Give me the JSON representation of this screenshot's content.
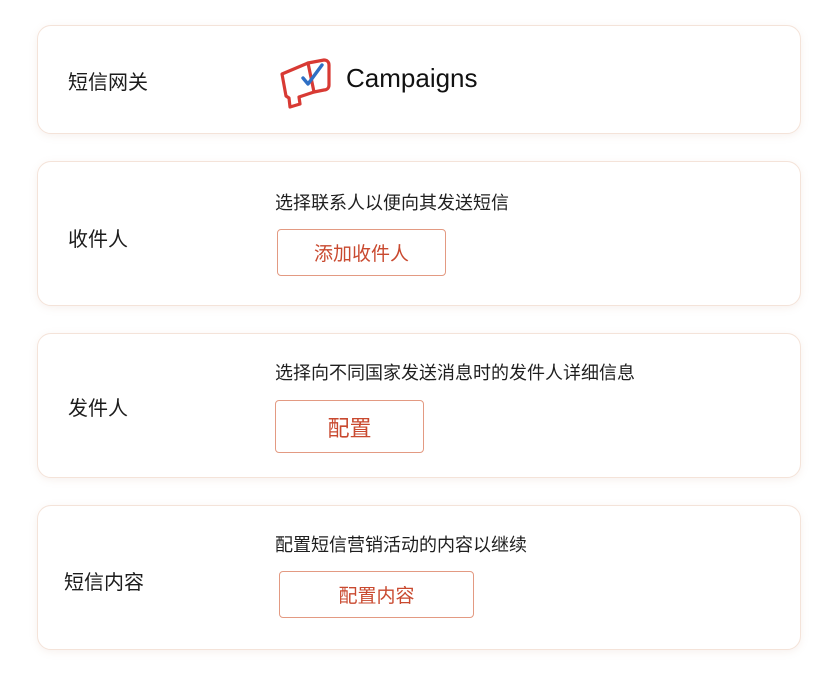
{
  "gateway": {
    "label": "短信网关",
    "brand_name": "Campaigns",
    "brand_icon": "campaigns-megaphone-icon"
  },
  "recipients": {
    "label": "收件人",
    "description": "选择联系人以便向其发送短信",
    "button_label": "添加收件人"
  },
  "sender": {
    "label": "发件人",
    "description": "选择向不同国家发送消息时的发件人详细信息",
    "button_label": "配置"
  },
  "content": {
    "label": "短信内容",
    "description": "配置短信营销活动的内容以继续",
    "button_label": "配置内容"
  },
  "colors": {
    "accent": "#c9492f",
    "button_border": "#e39a82",
    "card_border": "#f4e3d9",
    "logo_red": "#d83a34",
    "logo_blue": "#2f6fc4"
  }
}
